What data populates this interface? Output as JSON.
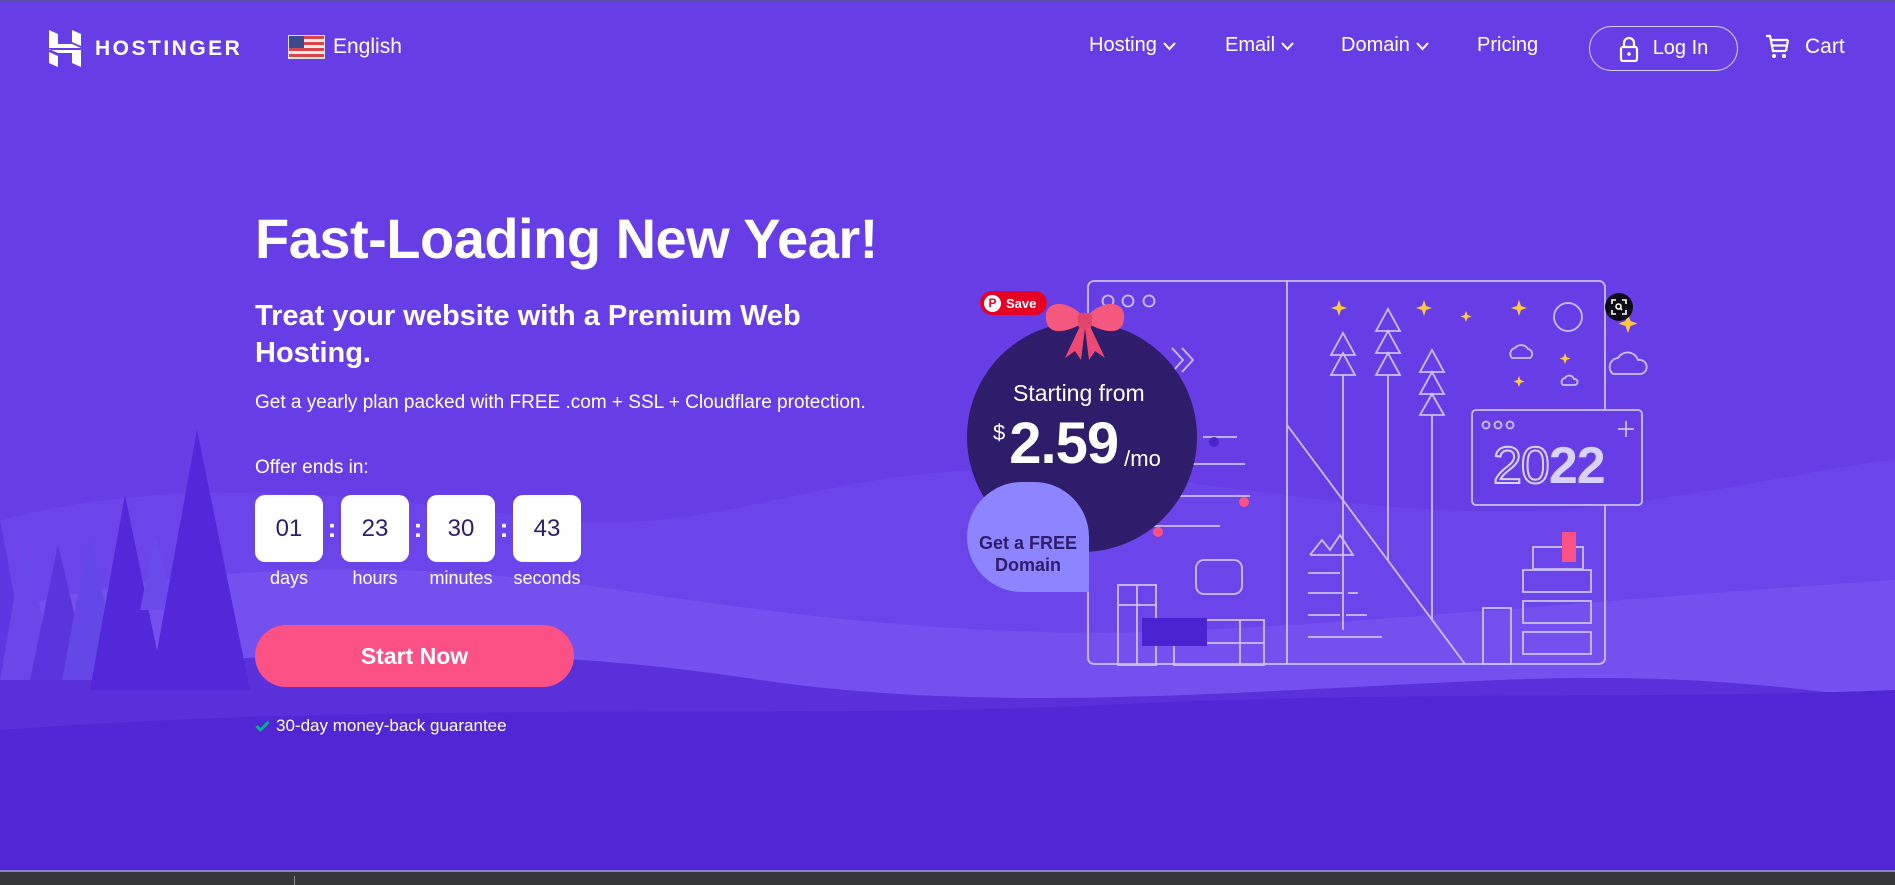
{
  "header": {
    "brand": "HOSTINGER",
    "language": {
      "label": "English",
      "flag_icon": "us-flag-icon"
    },
    "nav": [
      {
        "label": "Hosting",
        "has_dropdown": true
      },
      {
        "label": "Email",
        "has_dropdown": true
      },
      {
        "label": "Domain",
        "has_dropdown": true
      },
      {
        "label": "Pricing",
        "has_dropdown": false
      }
    ],
    "login_label": "Log In",
    "cart_label": "Cart"
  },
  "hero": {
    "title": "Fast-Loading New Year!",
    "subtitle": "Treat your website with a Premium Web Hosting.",
    "description": "Get a yearly plan packed with FREE .com + SSL + Cloudflare protection.",
    "offer_label": "Offer ends in:",
    "countdown": [
      {
        "value": "01",
        "label": "days"
      },
      {
        "value": "23",
        "label": "hours"
      },
      {
        "value": "30",
        "label": "minutes"
      },
      {
        "value": "43",
        "label": "seconds"
      }
    ],
    "separator": ":",
    "cta_label": "Start Now",
    "guarantee": "30-day money-back guarantee"
  },
  "promo": {
    "starting_from": "Starting from",
    "currency": "$",
    "price": "2.59",
    "period": "/mo",
    "free_domain": "Get a FREE Domain",
    "year_outline": "20",
    "year_solid": "22"
  },
  "overlays": {
    "pinterest_save": "Save",
    "visual_search_icon": "lens-search-icon"
  },
  "colors": {
    "brand_purple": "#673de6",
    "dark_purple": "#2f1c6a",
    "cta_pink": "#fc5185",
    "check_green": "#00b090",
    "pinterest_red": "#e60023"
  }
}
